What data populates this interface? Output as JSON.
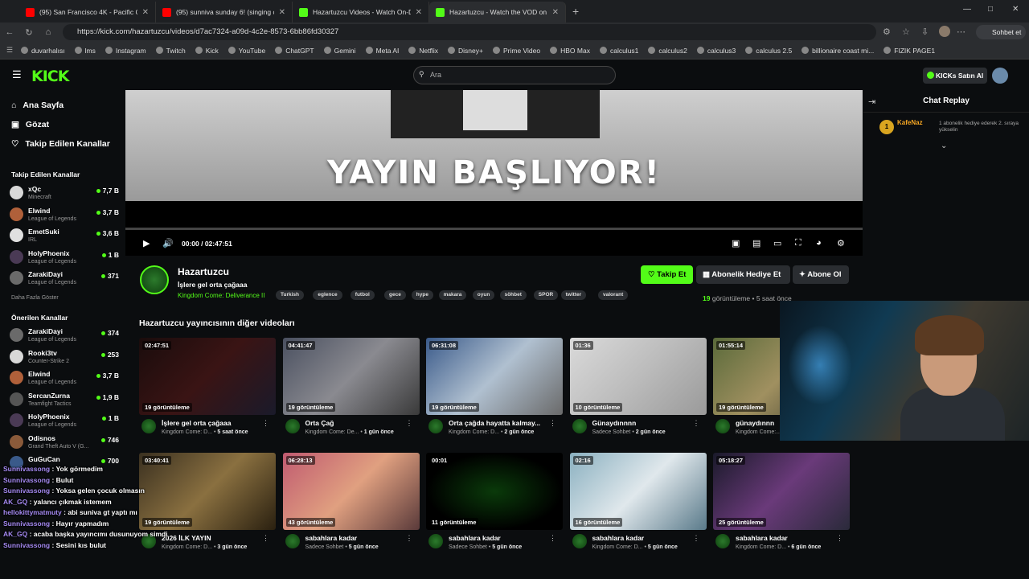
{
  "browser": {
    "tabs": [
      {
        "title": "(95) San Francisco 4K - Pacific Coa",
        "color": "#ff0000",
        "active": false
      },
      {
        "title": "(95) sunniva sunday 6! (singing co",
        "color": "#ff0000",
        "active": false
      },
      {
        "title": "Hazartuzcu Videos - Watch On-De",
        "color": "#53fc18",
        "active": false
      },
      {
        "title": "Hazartuzcu - Watch the VOD on K",
        "color": "#53fc18",
        "active": true
      }
    ],
    "new_tab": "+",
    "url": "https://kick.com/hazartuzcu/videos/d7ac7324-a09d-4c2e-8573-6bb86fd30327",
    "profile_button": "Sohbet et",
    "bookmarks": [
      "duvarhalısı",
      "lms",
      "Instagram",
      "Twitch",
      "Kick",
      "YouTube",
      "ChatGPT",
      "Gemini",
      "Meta AI",
      "Netflix",
      "Disney+",
      "Prime Video",
      "HBO Max",
      "calculus1",
      "calculus2",
      "calculus3",
      "calculus 2.5",
      "billionaire coast mi...",
      "FIZIK PAGE1"
    ]
  },
  "header": {
    "logo": "KICK",
    "search_placeholder": "Ara",
    "kicks_button": "KICKs Satın Al"
  },
  "sidebar": {
    "nav": [
      {
        "label": "Ana Sayfa",
        "icon": "home-icon"
      },
      {
        "label": "Gözat",
        "icon": "browse-icon"
      },
      {
        "label": "Takip Edilen Kanallar",
        "icon": "heart-icon"
      }
    ],
    "followed_heading": "Takip Edilen Kanallar",
    "followed": [
      {
        "name": "xQc",
        "game": "Minecraft",
        "viewers": "7,7 B",
        "color": "#d8d8d8"
      },
      {
        "name": "Elwind",
        "game": "League of Legends",
        "viewers": "3,7 B",
        "color": "#b0603a"
      },
      {
        "name": "EmetSuki",
        "game": "IRL",
        "viewers": "3,6 B",
        "color": "#e0e0e0"
      },
      {
        "name": "HolyPhoenix",
        "game": "League of Legends",
        "viewers": "1 B",
        "color": "#4a3a55"
      },
      {
        "name": "ZarakiDayi",
        "game": "League of Legends",
        "viewers": "371",
        "color": "#6a6a6a"
      }
    ],
    "followed_more": "Daha Fazla Göster",
    "recommended_heading": "Önerilen Kanallar",
    "recommended": [
      {
        "name": "ZarakiDayi",
        "game": "League of Legends",
        "viewers": "374",
        "color": "#6a6a6a"
      },
      {
        "name": "Rooki3tv",
        "game": "Counter-Strike 2",
        "viewers": "253",
        "color": "#d8d8d8"
      },
      {
        "name": "Elwind",
        "game": "League of Legends",
        "viewers": "3,7 B",
        "color": "#b0603a"
      },
      {
        "name": "SercanZurna",
        "game": "Teamfight Tactics",
        "viewers": "1,9 B",
        "color": "#555"
      },
      {
        "name": "HolyPhoenix",
        "game": "League of Legends",
        "viewers": "1 B",
        "color": "#4a3a55"
      },
      {
        "name": "Odisnos",
        "game": "Grand Theft Auto V (G...",
        "viewers": "746",
        "color": "#8a5a3a"
      },
      {
        "name": "GuGuCan",
        "game": "",
        "viewers": "700",
        "color": "#3a5a8a"
      }
    ]
  },
  "player": {
    "title_text": "YAYIN BAŞLIYOR!",
    "time": "00:00 / 02:47:51",
    "progress": 0
  },
  "chat": {
    "title": "Chat Replay",
    "user": "KafeNaz",
    "badge": "1",
    "message": "1 abonelik hediye ederek 2. sıraya yükselin"
  },
  "stream": {
    "streamer": "Hazartuzcu",
    "title": "İşlere gel orta çağaaa",
    "game": "Kingdom Come: Deliverance II",
    "tags": [
      "Turkish",
      "eglence",
      "futbol",
      "gece",
      "hype",
      "makara",
      "oyun",
      "söhbet",
      "SPOR",
      "twitter",
      "valorant"
    ],
    "follow_label": "Takip Et",
    "gift_label": "Abonelik Hediye Et",
    "subscribe_label": "Abone Ol",
    "views": "19",
    "views_label": "görüntüleme",
    "ago": "5 saat önce"
  },
  "other_videos_title": "Hazartuzcu yayıncısının diğer videoları",
  "videos": [
    {
      "duration": "02:47:51",
      "views": "19 görüntüleme",
      "title": "İşlere gel orta çağaaa",
      "category": "Kingdom Come: D...",
      "ago": "5 saat önce",
      "bg": "linear-gradient(135deg,#1a0c0c,#3a1414 50%,#1a1a2a)"
    },
    {
      "duration": "04:41:47",
      "views": "19 görüntüleme",
      "title": "Orta Çağ",
      "category": "Kingdom Come: De...",
      "ago": "1 gün önce",
      "bg": "linear-gradient(135deg,#4a5060,#8a8a90 50%,#3a3a3a)"
    },
    {
      "duration": "06:31:08",
      "views": "19 görüntüleme",
      "title": "Orta çağda hayatta kalmay...",
      "category": "Kingdom Come: D...",
      "ago": "2 gün önce",
      "bg": "linear-gradient(135deg,#3a5a8a,#b0c0d0 50%,#6a6a6a)"
    },
    {
      "duration": "01:36",
      "views": "10 görüntüleme",
      "title": "Günaydınnnn",
      "category": "Sadece Sohbet",
      "ago": "2 gün önce",
      "bg": "linear-gradient(135deg,#dadada,#bcbcbc 50%,#9a9a9a)"
    },
    {
      "duration": "01:55:14",
      "views": "19 görüntüleme",
      "title": "günaydınnn",
      "category": "Kingdom Come:...",
      "ago": "",
      "bg": "linear-gradient(135deg,#5a6a3a,#a09060 50%,#3a3a2a)"
    },
    {
      "duration": "03:40:41",
      "views": "19 görüntüleme",
      "title": "2026 İLK YAYIN",
      "category": "Kingdom Come: D...",
      "ago": "3 gün önce",
      "bg": "linear-gradient(135deg,#3a3020,#8a7040 50%,#2a2010)"
    },
    {
      "duration": "06:28:13",
      "views": "43 görüntüleme",
      "title": "sabahlara kadar",
      "category": "Sadece Sohbet",
      "ago": "5 gün önce",
      "bg": "linear-gradient(135deg,#c05a70,#e0a080 50%,#5a3a3a)"
    },
    {
      "duration": "00:01",
      "views": "11 görüntüleme",
      "title": "sabahlara kadar",
      "category": "Sadece Sohbet",
      "ago": "5 gün önce",
      "bg": "radial-gradient(#0a3a0a,#000 70%)"
    },
    {
      "duration": "02:16",
      "views": "16 görüntüleme",
      "title": "sabahlara kadar",
      "category": "Kingdom Come: D...",
      "ago": "5 gün önce",
      "bg": "linear-gradient(135deg,#8ab0c0,#e0e8ec 50%,#5a7a8a)"
    },
    {
      "duration": "05:18:27",
      "views": "25 görüntüleme",
      "title": "sabahlara kadar",
      "category": "Kingdom Come: D...",
      "ago": "6 gün önce",
      "bg": "linear-gradient(135deg,#1a1a2a,#6a3a7a 50%,#2a2a3a)"
    }
  ],
  "overlay_chat": [
    {
      "user": "Sunnivassong",
      "text": ": Yok görmedim"
    },
    {
      "user": "Sunnivassong",
      "text": ": Bulut"
    },
    {
      "user": "Sunnivassong",
      "text": ": Yoksa gelen çocuk olmasın"
    },
    {
      "user": "AK_GQ",
      "text": ": yalancı çıkmak istemem"
    },
    {
      "user": "hellokittymatmuty",
      "text": ": abi suniva gt yaptı mı"
    },
    {
      "user": "Sunnivassong",
      "text": ": Hayır yapmadım"
    },
    {
      "user": "AK_GQ",
      "text": ": acaba başka yayıncımı dusunuyom simdi"
    },
    {
      "user": "Sunnivassong",
      "text": ": Sesini kıs bulut"
    }
  ]
}
